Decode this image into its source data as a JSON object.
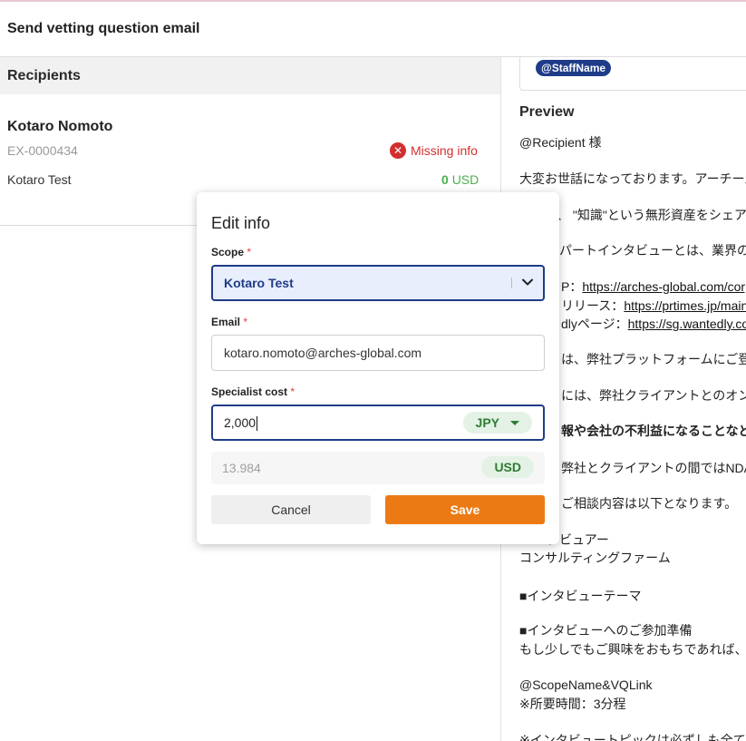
{
  "header": {
    "title": "Send vetting question email"
  },
  "recipients": {
    "heading": "Recipients",
    "name": "Kotaro Nomoto",
    "id": "EX-0000434",
    "status": "Missing info",
    "scope": "Kotaro Test",
    "cost_value": "0",
    "cost_currency": "USD"
  },
  "preview": {
    "variable_chip": "@StaffName",
    "title": "Preview",
    "lines": [
      "@Recipient 様",
      "大変お世話になっております。アーチーズ",
      "、 \"知識\"という無形資産をシェア",
      "パートインタビューとは、業界の",
      "P：",
      "https://arches-global.com/corpo",
      "リリース：",
      "https://prtimes.jp/main",
      "dlyページ：",
      "https://sg.wantedly.com",
      "は、弊社プラットフォームにご登",
      "には、弊社クライアントとのオン",
      "報や会社の不利益になることなど",
      "弊社とクライアントの間ではNDA",
      "ご相談内容は以下となります。",
      "タビュアー",
      "コンサルティングファーム",
      "■インタビューテーマ",
      "■インタビューへのご参加準備",
      "もし少しでもご興味をおもちであれば、",
      "@ScopeName&VQLink",
      "※所要時間：3分程",
      "※インタビュートピックは必ずしも全て"
    ]
  },
  "modal": {
    "title": "Edit info",
    "scope_label": "Scope",
    "scope_value": "Kotaro Test",
    "email_label": "Email",
    "email_value": "kotaro.nomoto@arches-global.com",
    "cost_label": "Specialist cost",
    "cost_value": "2,000",
    "cost_currency": "JPY",
    "converted_value": "13.984",
    "converted_currency": "USD",
    "required_mark": "*",
    "cancel_label": "Cancel",
    "save_label": "Save"
  }
}
